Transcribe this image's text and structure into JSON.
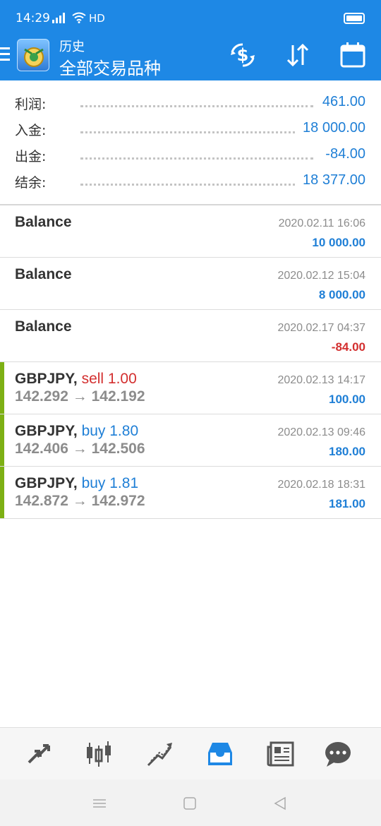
{
  "status_bar": {
    "time": "14:29",
    "network": "HD"
  },
  "app_bar": {
    "title": "历史",
    "subtitle": "全部交易品种"
  },
  "summary": [
    {
      "label": "利润:",
      "value": "461.00"
    },
    {
      "label": "入金:",
      "value": "18 000.00"
    },
    {
      "label": "出金:",
      "value": "-84.00"
    },
    {
      "label": "结余:",
      "value": "18 377.00"
    }
  ],
  "balances": [
    {
      "name": "Balance",
      "time": "2020.02.11 16:06",
      "amount": "10 000.00",
      "sign": "positive"
    },
    {
      "name": "Balance",
      "time": "2020.02.12 15:04",
      "amount": "8 000.00",
      "sign": "positive"
    },
    {
      "name": "Balance",
      "time": "2020.02.17 04:37",
      "amount": "-84.00",
      "sign": "negative"
    }
  ],
  "trades": [
    {
      "symbol": "GBPJPY,",
      "operation": "sell 1.00",
      "side": "sell",
      "open_price": "142.292",
      "close_price": "142.192",
      "time": "2020.02.13 14:17",
      "profit": "100.00"
    },
    {
      "symbol": "GBPJPY,",
      "operation": "buy 1.80",
      "side": "buy",
      "open_price": "142.406",
      "close_price": "142.506",
      "time": "2020.02.13 09:46",
      "profit": "180.00"
    },
    {
      "symbol": "GBPJPY,",
      "operation": "buy 1.81",
      "side": "buy",
      "open_price": "142.872",
      "close_price": "142.972",
      "time": "2020.02.18 18:31",
      "profit": "181.00"
    }
  ],
  "price_arrow": "→",
  "tabs": [
    {
      "icon": "quotes-icon",
      "active": false
    },
    {
      "icon": "chart-candles-icon",
      "active": false
    },
    {
      "icon": "trade-icon",
      "active": false
    },
    {
      "icon": "history-inbox-icon",
      "active": true
    },
    {
      "icon": "news-icon",
      "active": false
    },
    {
      "icon": "chat-icon",
      "active": false
    }
  ],
  "colors": {
    "header": "#1e88e5",
    "positive": "#1f7fd6",
    "negative": "#d32f2f",
    "trade_marker": "#7db014",
    "active_tab": "#1e88e5",
    "inactive_tab": "#555555"
  }
}
